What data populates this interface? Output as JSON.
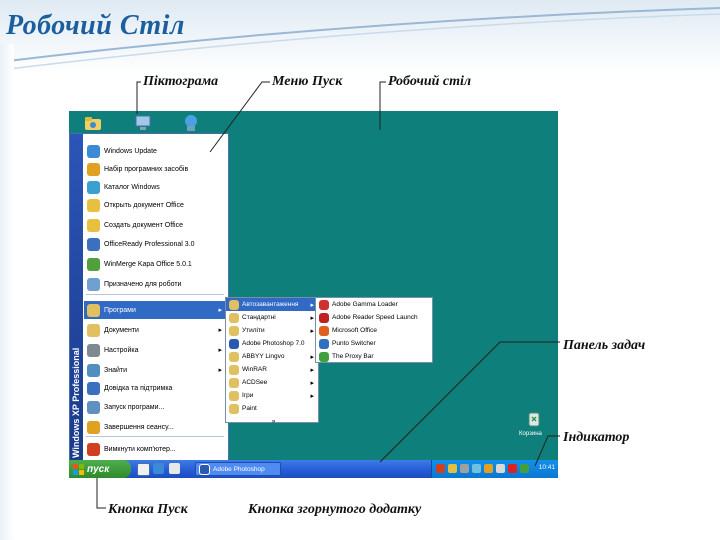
{
  "slide": {
    "title": "Робочий Стіл"
  },
  "annotations": {
    "icon": "Піктограма",
    "start_menu": "Меню Пуск",
    "desktop": "Робочий стіл",
    "taskbar": "Панель задач",
    "indicator": "Індикатор",
    "start_button": "Кнопка Пуск",
    "minimized_app_button": "Кнопка згорнутого додатку"
  },
  "start_menu": {
    "side_label": "Windows XP Professional",
    "items": [
      {
        "label": "Windows Update",
        "color": "#3a8ad8"
      },
      {
        "label": "Набір програмних засобів",
        "color": "#e0a020"
      },
      {
        "label": "Каталог Windows",
        "color": "#3aa0d0"
      },
      {
        "label": "Открыть документ Office",
        "color": "#e8c040"
      },
      {
        "label": "Создать документ Office",
        "color": "#e8c040"
      },
      {
        "label": "OfficeReady Professional 3.0",
        "color": "#3a70c0"
      },
      {
        "label": "WinMerge Kapa Office 5.0.1",
        "color": "#50a040"
      },
      {
        "label": "Призначено для роботи",
        "color": "#70a0d0"
      },
      {
        "label": "Програми",
        "color": "#e0c060"
      },
      {
        "label": "Документи",
        "color": "#e0c060"
      },
      {
        "label": "Настройка",
        "color": "#808890"
      },
      {
        "label": "Знайти",
        "color": "#5090c0"
      },
      {
        "label": "Довідка та підтримка",
        "color": "#3a70c0"
      },
      {
        "label": "Запуск програми...",
        "color": "#6090c0"
      },
      {
        "label": "Завершення сеансу...",
        "color": "#e0a020"
      },
      {
        "label": "Вимкнути комп'ютер...",
        "color": "#d04020"
      }
    ]
  },
  "programs_menu": {
    "items": [
      {
        "label": "Автозавантаження"
      },
      {
        "label": "Стандартні"
      },
      {
        "label": "Утиліти"
      },
      {
        "label": "Adobe Photoshop 7.0"
      },
      {
        "label": "ABBYY Lingvo"
      },
      {
        "label": "WinRAR"
      },
      {
        "label": "ACDSee"
      },
      {
        "label": "Ігри"
      },
      {
        "label": "Paint"
      }
    ],
    "more": "»"
  },
  "autostart_menu": {
    "items": [
      {
        "label": "Adobe Gamma Loader"
      },
      {
        "label": "Adobe Reader Speed Launch"
      },
      {
        "label": "Microsoft Office"
      },
      {
        "label": "Punto Switcher"
      },
      {
        "label": "The Proxy Bar"
      }
    ]
  },
  "taskbar": {
    "start_label": "пуск",
    "task_button_label": "Adobe Photoshop",
    "clock": "10:41"
  },
  "desktop_icon": {
    "label": "Корзина"
  }
}
